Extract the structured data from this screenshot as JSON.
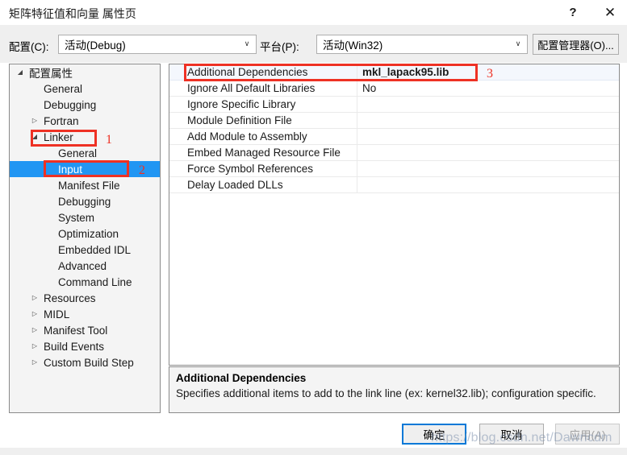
{
  "window": {
    "title": "矩阵特征值和向量 属性页",
    "help_glyph": "?",
    "close_glyph": "✕"
  },
  "config_bar": {
    "configuration_label": "配置(C):",
    "configuration_value": "活动(Debug)",
    "platform_label": "平台(P):",
    "platform_value": "活动(Win32)",
    "config_manager_label": "配置管理器(O)...",
    "dropdown_arrow": "∨"
  },
  "tree": {
    "expander_collapsed": "▷",
    "expander_expanded": "◢",
    "items": [
      {
        "label": "配置属性",
        "level": 0,
        "expander": "expanded",
        "selected": false
      },
      {
        "label": "General",
        "level": 1,
        "expander": "none",
        "selected": false
      },
      {
        "label": "Debugging",
        "level": 1,
        "expander": "none",
        "selected": false
      },
      {
        "label": "Fortran",
        "level": 1,
        "expander": "collapsed",
        "selected": false
      },
      {
        "label": "Linker",
        "level": 1,
        "expander": "expanded",
        "selected": false
      },
      {
        "label": "General",
        "level": 2,
        "expander": "none",
        "selected": false
      },
      {
        "label": "Input",
        "level": 2,
        "expander": "none",
        "selected": true
      },
      {
        "label": "Manifest File",
        "level": 2,
        "expander": "none",
        "selected": false
      },
      {
        "label": "Debugging",
        "level": 2,
        "expander": "none",
        "selected": false
      },
      {
        "label": "System",
        "level": 2,
        "expander": "none",
        "selected": false
      },
      {
        "label": "Optimization",
        "level": 2,
        "expander": "none",
        "selected": false
      },
      {
        "label": "Embedded IDL",
        "level": 2,
        "expander": "none",
        "selected": false
      },
      {
        "label": "Advanced",
        "level": 2,
        "expander": "none",
        "selected": false
      },
      {
        "label": "Command Line",
        "level": 2,
        "expander": "none",
        "selected": false
      },
      {
        "label": "Resources",
        "level": 1,
        "expander": "collapsed",
        "selected": false
      },
      {
        "label": "MIDL",
        "level": 1,
        "expander": "collapsed",
        "selected": false
      },
      {
        "label": "Manifest Tool",
        "level": 1,
        "expander": "collapsed",
        "selected": false
      },
      {
        "label": "Build Events",
        "level": 1,
        "expander": "collapsed",
        "selected": false
      },
      {
        "label": "Custom Build Step",
        "level": 1,
        "expander": "collapsed",
        "selected": false
      }
    ]
  },
  "properties": {
    "rows": [
      {
        "name": "Additional Dependencies",
        "value": "mkl_lapack95.lib",
        "selected": true
      },
      {
        "name": "Ignore All Default Libraries",
        "value": "No",
        "selected": false
      },
      {
        "name": "Ignore Specific Library",
        "value": "",
        "selected": false
      },
      {
        "name": "Module Definition File",
        "value": "",
        "selected": false
      },
      {
        "name": "Add Module to Assembly",
        "value": "",
        "selected": false
      },
      {
        "name": "Embed Managed Resource File",
        "value": "",
        "selected": false
      },
      {
        "name": "Force Symbol References",
        "value": "",
        "selected": false
      },
      {
        "name": "Delay Loaded DLLs",
        "value": "",
        "selected": false
      }
    ]
  },
  "description": {
    "title": "Additional Dependencies",
    "body": "Specifies additional items to add to the link line (ex: kernel32.lib); configuration specific."
  },
  "buttons": {
    "ok": "确定",
    "cancel": "取消",
    "apply": "应用(A)"
  },
  "annotations": {
    "one": "1",
    "two": "2",
    "three": "3",
    "accent_color": "#ee3124"
  },
  "watermark": {
    "text": "https://blog.csdn.net/Dawncdm"
  }
}
